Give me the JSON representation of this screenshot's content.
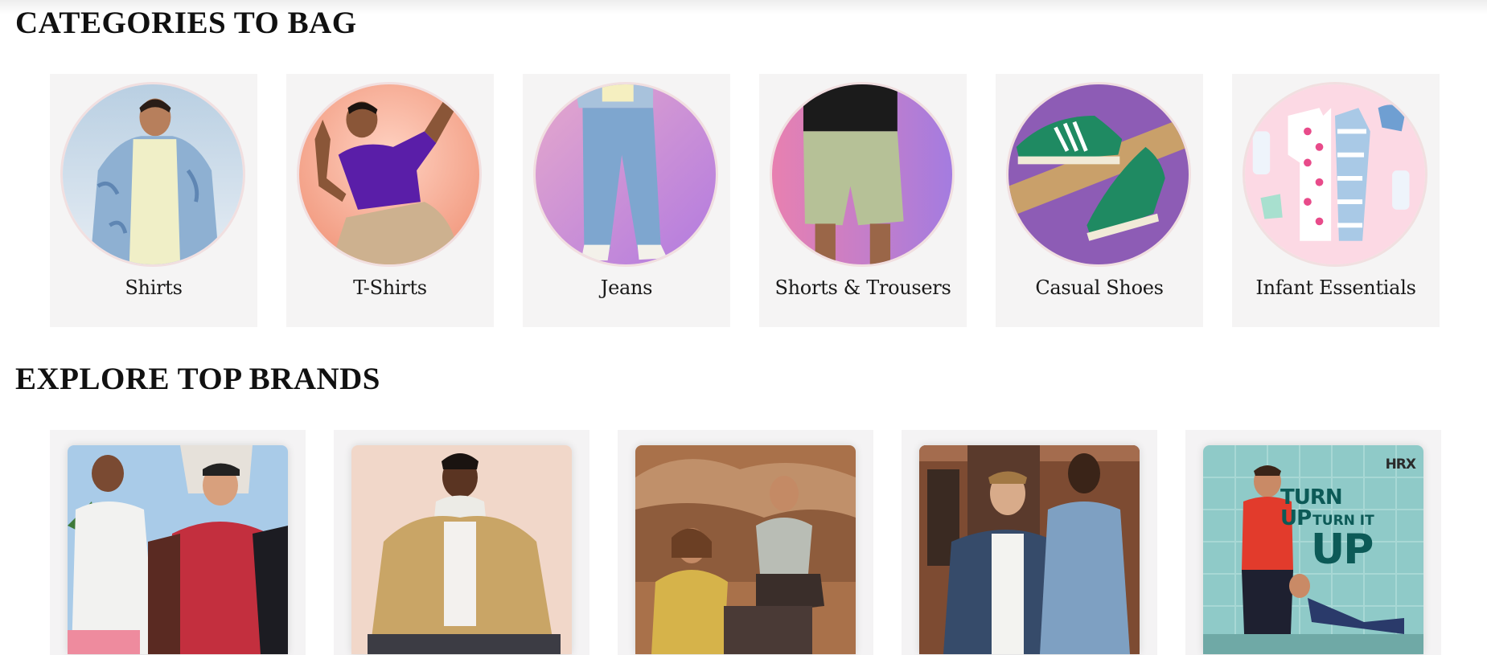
{
  "sections": {
    "categories_title": "CATEGORIES TO BAG",
    "brands_title": "EXPLORE TOP BRANDS"
  },
  "categories": [
    {
      "label": "Shirts",
      "icon": "shirt-photo"
    },
    {
      "label": "T-Shirts",
      "icon": "tshirt-photo"
    },
    {
      "label": "Jeans",
      "icon": "jeans-photo"
    },
    {
      "label": "Shorts & Trousers",
      "icon": "shorts-photo"
    },
    {
      "label": "Casual Shoes",
      "icon": "shoes-photo"
    },
    {
      "label": "Infant Essentials",
      "icon": "infant-photo"
    }
  ],
  "brands": [
    {
      "icon": "sportswear-brand-photo"
    },
    {
      "icon": "casual-jacket-brand-photo"
    },
    {
      "icon": "outdoor-brand-photo"
    },
    {
      "icon": "denim-brand-photo"
    },
    {
      "icon": "hrx-brand-photo",
      "logo": "HRX",
      "slogan_line1": "TURN",
      "slogan_line2": "UP",
      "slogan_line2b": "TURN IT",
      "slogan_line3": "UP"
    }
  ],
  "colors": {
    "card_bg": "#f5f4f4",
    "circle_border": "#f1dfe0",
    "title_color": "#111111"
  }
}
